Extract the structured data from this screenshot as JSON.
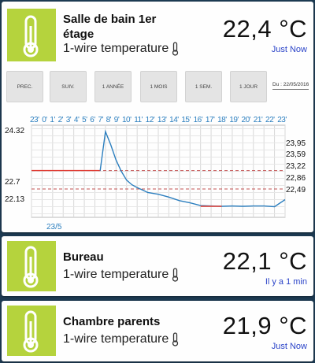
{
  "cards": [
    {
      "name": "Salle de bain 1er",
      "name_line2": "étage",
      "sensor": "1-wire temperature",
      "temperature": "22,4 °C",
      "updated": "Just Now"
    },
    {
      "name": "Bureau",
      "sensor": "1-wire temperature",
      "temperature": "22,1 °C",
      "updated": "Il y a 1 min"
    },
    {
      "name": "Chambre parents",
      "sensor": "1-wire temperature",
      "temperature": "21,9 °C",
      "updated": "Just Now"
    }
  ],
  "controls": {
    "prev": "PREC.",
    "next": "SUIV.",
    "year": "1 ANNÉE",
    "month": "1 MOIS",
    "week": "1 SEM.",
    "day": "1 JOUR",
    "date": "Du : 22/05/2016"
  },
  "icons": {
    "thermometer": "thermometer-icon",
    "sensor": "thermometer-small-icon"
  },
  "colors": {
    "tile": "#b5d33d",
    "accent_blue": "#2a43c8",
    "line": "#2c7fbf",
    "red": "#e03a32"
  },
  "chart_data": {
    "type": "line",
    "x_hours": [
      "23'",
      "0'",
      "1'",
      "2'",
      "3'",
      "4'",
      "5'",
      "6'",
      "7'",
      "8'",
      "9'",
      "10'",
      "11'",
      "12'",
      "13'",
      "14'",
      "15'",
      "16'",
      "17'",
      "18'",
      "19'",
      "20'",
      "21'",
      "22'",
      "23'"
    ],
    "y_left_labels": [
      "24.32",
      "22.7",
      "22.13"
    ],
    "y_right_labels": [
      "23,95",
      "23,59",
      "23,22",
      "22,86",
      "22,49"
    ],
    "day_label": "23/5",
    "series": [
      {
        "color": "red",
        "x": [
          0,
          1,
          2,
          3,
          4,
          5,
          6,
          6.5
        ],
        "y": [
          23.22,
          23.22,
          23.22,
          23.22,
          23.22,
          23.22,
          23.22,
          23.22
        ]
      },
      {
        "color": "blue",
        "x": [
          6.5,
          7,
          7.5,
          8,
          8.5,
          9,
          9.5,
          10,
          10.5,
          11,
          12,
          13,
          14,
          15,
          16,
          17,
          18,
          19,
          20,
          21,
          22,
          23,
          24
        ],
        "y": [
          23.22,
          24.32,
          23.95,
          23.52,
          23.2,
          22.95,
          22.82,
          22.74,
          22.67,
          22.6,
          22.55,
          22.47,
          22.37,
          22.31,
          22.23,
          22.22,
          22.21,
          22.22,
          22.21,
          22.22,
          22.22,
          22.2,
          22.4
        ]
      },
      {
        "color": "red",
        "x": [
          16,
          18
        ],
        "y": [
          22.21,
          22.21
        ]
      }
    ],
    "reference_lines": [
      23.22,
      22.7
    ],
    "ylim": [
      21.9,
      24.5
    ],
    "grid": true
  }
}
